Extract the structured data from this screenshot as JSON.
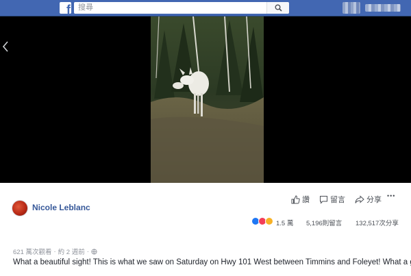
{
  "header": {
    "logo_letter": "f",
    "search_placeholder": "搜尋"
  },
  "post": {
    "author": "Nicole Leblanc",
    "actions": {
      "like": "讚",
      "comment": "留言",
      "share": "分享",
      "more": "•••"
    },
    "reactions_count": "1.5 萬",
    "comments_count": "5,196則留言",
    "shares_count": "132,517次分享",
    "views": "621 萬次觀看",
    "separator": "·",
    "time": "約 2 週前",
    "caption": "What a beautiful sight! This is what we saw on Saturday on Hwy 101 West between Timmins and Foleyet! What a gift!!!"
  },
  "colors": {
    "top_bar": "#4267b2",
    "link": "#365899",
    "like_reaction": "#2078f4",
    "love_reaction": "#f33e58",
    "wow_reaction": "#f7b125"
  }
}
